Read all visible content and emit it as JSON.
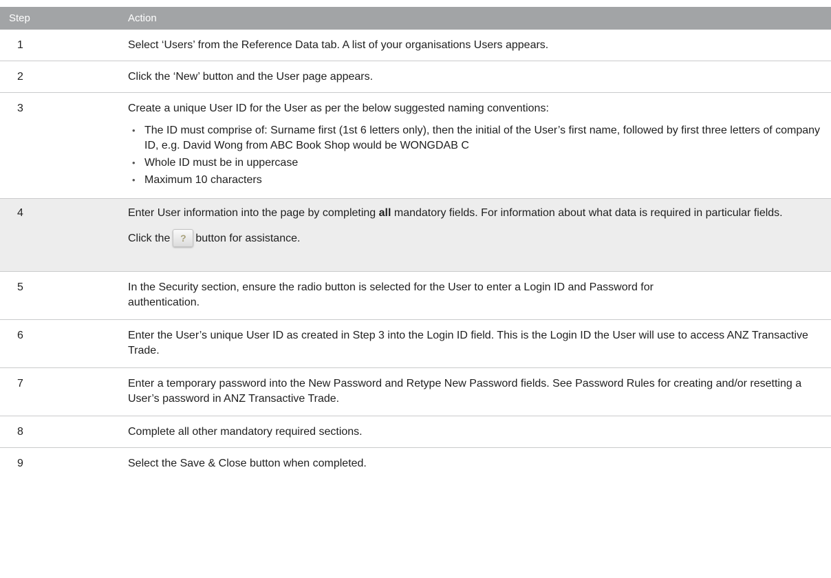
{
  "table": {
    "headers": {
      "step": "Step",
      "action": "Action"
    },
    "rows": [
      {
        "step": "1",
        "text": "Select ‘Users’ from the Reference Data tab. A list of your organisations Users appears."
      },
      {
        "step": "2",
        "text": "Click the ‘New’ button and the User page appears."
      },
      {
        "step": "3",
        "text": "Create a unique User ID for the User as per the below suggested naming conventions:",
        "bullets": [
          "The ID must comprise of: Surname first (1st 6 letters only), then the initial of the User’s first name, followed by first three letters of company ID, e.g. David Wong from ABC Book Shop would be WONGDAB C",
          "Whole ID must be in uppercase",
          "Maximum 10 characters"
        ]
      },
      {
        "step": "4",
        "text_before_bold": "Enter User information into the page by completing ",
        "bold": "all",
        "text_after_bold": " mandatory fields. For information about what data is required in particular fields.",
        "help_before": "Click the",
        "help_icon": "?",
        "help_after": "button for assistance."
      },
      {
        "step": "5",
        "text": "In the Security section, ensure the radio button is selected for the User to enter a Login ID and Password for authentication."
      },
      {
        "step": "6",
        "text": "Enter the User’s unique User ID as created in Step 3 into the Login ID field. This is the Login ID the User will use to access ANZ Transactive Trade."
      },
      {
        "step": "7",
        "text": "Enter a temporary password into the New Password and Retype New Password fields. See Password Rules for creating and/or resetting a User’s password in ANZ Transactive Trade."
      },
      {
        "step": "8",
        "text": "Complete all other mandatory required sections."
      },
      {
        "step": "9",
        "text": "Select the Save & Close button when completed."
      }
    ]
  },
  "colors": {
    "header_bg": "#a2a4a6",
    "shaded_row_bg": "#ededed",
    "row_border": "#c9cacb"
  }
}
